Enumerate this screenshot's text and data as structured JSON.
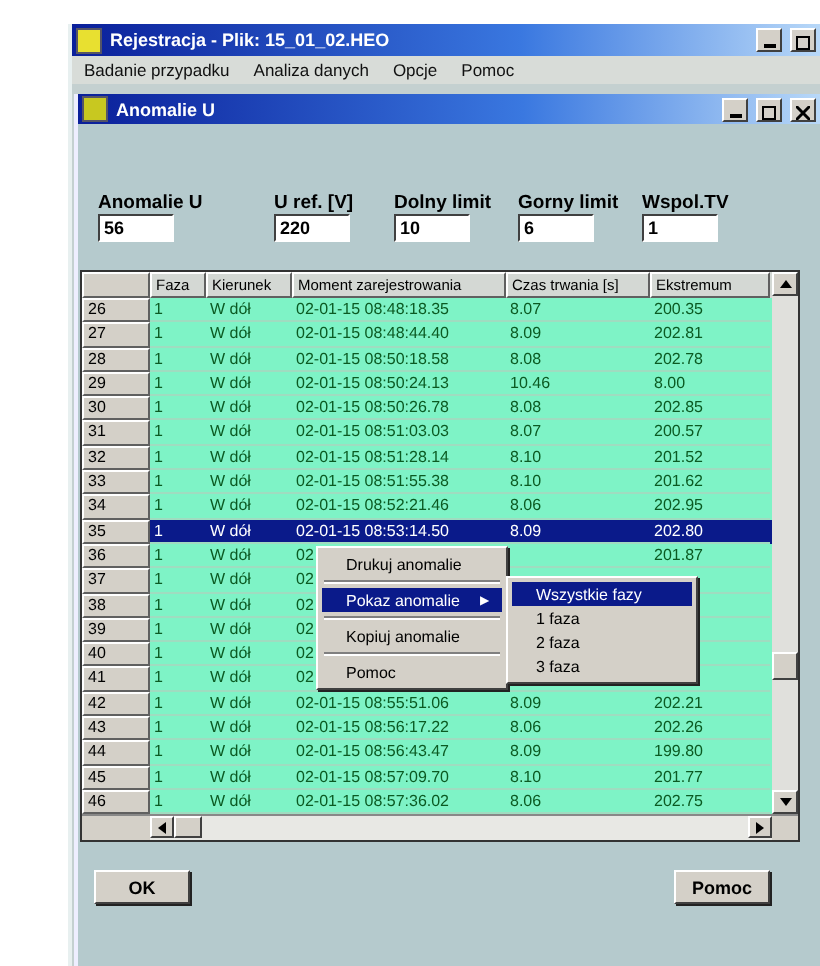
{
  "window": {
    "title": "Rejestracja - Plik: 15_01_02.HEO"
  },
  "menu": [
    "Badanie przypadku",
    "Analiza danych",
    "Opcje",
    "Pomoc"
  ],
  "child_window": {
    "title": "Anomalie U"
  },
  "fields": [
    {
      "label": "Anomalie U",
      "value": "56"
    },
    {
      "label": "U ref. [V]",
      "value": "220"
    },
    {
      "label": "Dolny limit",
      "value": "10"
    },
    {
      "label": "Gorny limit",
      "value": "6"
    },
    {
      "label": "Wspol.TV",
      "value": "1"
    }
  ],
  "table": {
    "columns": [
      "Faza",
      "Kierunek",
      "Moment zarejestrowania",
      "Czas trwania [s]",
      "Ekstremum"
    ],
    "rows": [
      {
        "num": "26",
        "faza": "1",
        "kierunek": "W dół",
        "moment": "02-01-15 08:48:18.35",
        "czas": "8.07",
        "ekstremum": "200.35",
        "selected": false
      },
      {
        "num": "27",
        "faza": "1",
        "kierunek": "W dół",
        "moment": "02-01-15 08:48:44.40",
        "czas": "8.09",
        "ekstremum": "202.81",
        "selected": false
      },
      {
        "num": "28",
        "faza": "1",
        "kierunek": "W dół",
        "moment": "02-01-15 08:50:18.58",
        "czas": "8.08",
        "ekstremum": "202.78",
        "selected": false
      },
      {
        "num": "29",
        "faza": "1",
        "kierunek": "W dół",
        "moment": "02-01-15 08:50:24.13",
        "czas": "10.46",
        "ekstremum": "8.00",
        "selected": false
      },
      {
        "num": "30",
        "faza": "1",
        "kierunek": "W dół",
        "moment": "02-01-15 08:50:26.78",
        "czas": "8.08",
        "ekstremum": "202.85",
        "selected": false
      },
      {
        "num": "31",
        "faza": "1",
        "kierunek": "W dół",
        "moment": "02-01-15 08:51:03.03",
        "czas": "8.07",
        "ekstremum": "200.57",
        "selected": false
      },
      {
        "num": "32",
        "faza": "1",
        "kierunek": "W dół",
        "moment": "02-01-15 08:51:28.14",
        "czas": "8.10",
        "ekstremum": "201.52",
        "selected": false
      },
      {
        "num": "33",
        "faza": "1",
        "kierunek": "W dół",
        "moment": "02-01-15 08:51:55.38",
        "czas": "8.10",
        "ekstremum": "201.62",
        "selected": false
      },
      {
        "num": "34",
        "faza": "1",
        "kierunek": "W dół",
        "moment": "02-01-15 08:52:21.46",
        "czas": "8.06",
        "ekstremum": "202.95",
        "selected": false
      },
      {
        "num": "35",
        "faza": "1",
        "kierunek": "W dół",
        "moment": "02-01-15 08:53:14.50",
        "czas": "8.09",
        "ekstremum": "202.80",
        "selected": true
      },
      {
        "num": "36",
        "faza": "1",
        "kierunek": "W dół",
        "moment": "02",
        "ekstremum": "201.87",
        "selected": false
      },
      {
        "num": "37",
        "faza": "1",
        "kierunek": "W dół",
        "moment": "02",
        "selected": false
      },
      {
        "num": "38",
        "faza": "1",
        "kierunek": "W dół",
        "moment": "02",
        "selected": false
      },
      {
        "num": "39",
        "faza": "1",
        "kierunek": "W dół",
        "moment": "02",
        "selected": false
      },
      {
        "num": "40",
        "faza": "1",
        "kierunek": "W dół",
        "moment": "02",
        "selected": false
      },
      {
        "num": "41",
        "faza": "1",
        "kierunek": "W dół",
        "moment": "02",
        "selected": false
      },
      {
        "num": "42",
        "faza": "1",
        "kierunek": "W dół",
        "moment": "02-01-15 08:55:51.06",
        "czas": "8.09",
        "ekstremum": "202.21",
        "selected": false
      },
      {
        "num": "43",
        "faza": "1",
        "kierunek": "W dół",
        "moment": "02-01-15 08:56:17.22",
        "czas": "8.06",
        "ekstremum": "202.26",
        "selected": false
      },
      {
        "num": "44",
        "faza": "1",
        "kierunek": "W dół",
        "moment": "02-01-15 08:56:43.47",
        "czas": "8.09",
        "ekstremum": "199.80",
        "selected": false
      },
      {
        "num": "45",
        "faza": "1",
        "kierunek": "W dół",
        "moment": "02-01-15 08:57:09.70",
        "czas": "8.10",
        "ekstremum": "201.77",
        "selected": false
      },
      {
        "num": "46",
        "faza": "1",
        "kierunek": "W dół",
        "moment": "02-01-15 08:57:36.02",
        "czas": "8.06",
        "ekstremum": "202.75",
        "selected": false
      }
    ]
  },
  "context_menu": [
    {
      "label": "Drukuj anomalie",
      "submenu": false,
      "selected": false
    },
    {
      "label": "Pokaz anomalie",
      "submenu": true,
      "selected": true
    },
    {
      "label": "Kopiuj anomalie",
      "submenu": false,
      "selected": false
    },
    {
      "label": "Pomoc",
      "submenu": false,
      "selected": false
    }
  ],
  "submenu_arrow": "▶",
  "submenu": [
    {
      "label": "Wszystkie fazy",
      "selected": true
    },
    {
      "label": "1 faza",
      "selected": false
    },
    {
      "label": "2 faza",
      "selected": false
    },
    {
      "label": "3 faza",
      "selected": false
    }
  ],
  "buttons": [
    "OK",
    "Pomoc"
  ]
}
